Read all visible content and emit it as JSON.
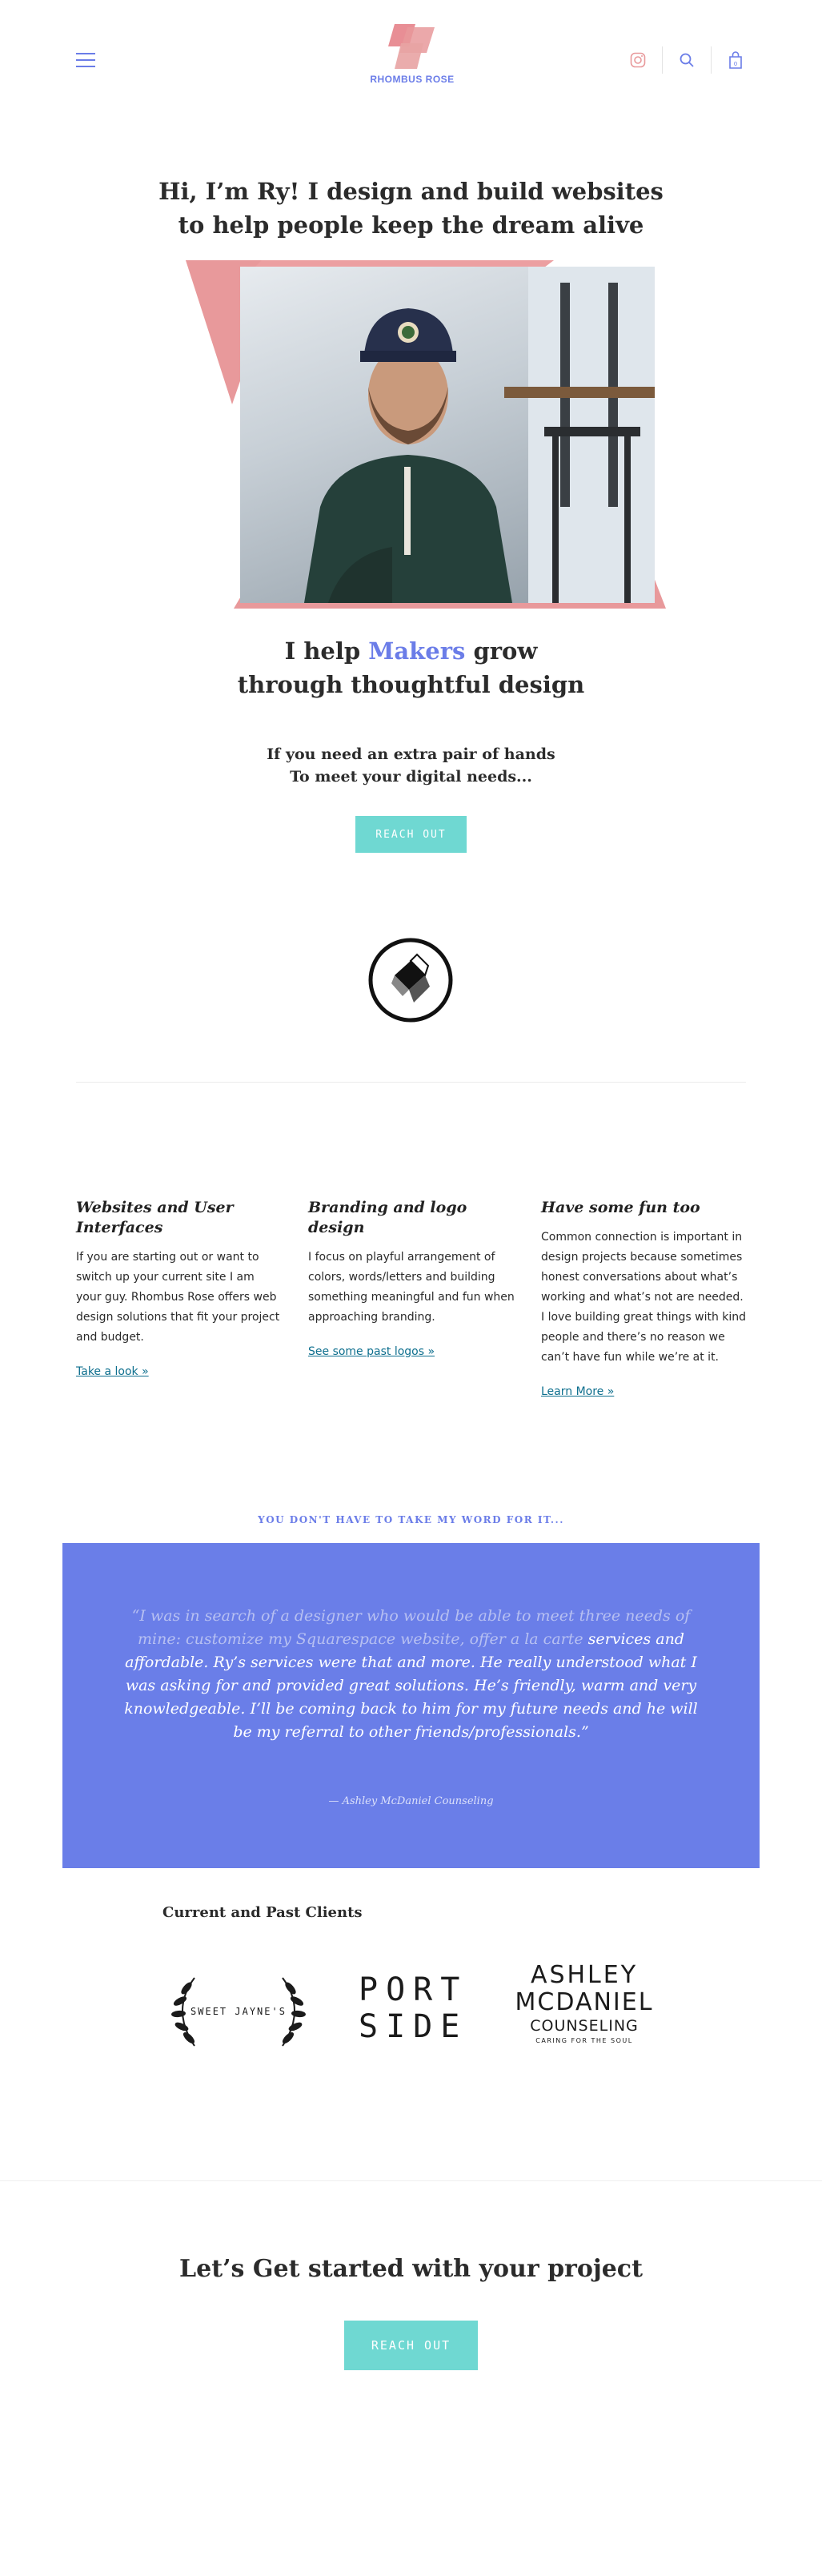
{
  "header": {
    "brand": "RHOMBUS ROSE",
    "cart_count": "0",
    "colors": {
      "accent": "#6b7de8",
      "pink": "#e8999b",
      "teal": "#6fd8d2"
    }
  },
  "hero": {
    "title": "Hi, I’m Ry! I design and build websites to help people keep the dream alive"
  },
  "makers": {
    "prefix": "I help",
    "highlight": "Makers",
    "suffix": "grow",
    "line2": "through thoughtful design"
  },
  "need": {
    "line1": "If you need an extra pair of hands",
    "line2": "To meet your digital needs..."
  },
  "cta_primary": {
    "label": "REACH OUT"
  },
  "services": [
    {
      "title": "Websites and User Interfaces",
      "body": "If you are starting out or want to switch up your current site I am your guy. Rhombus Rose offers web design solutions that fit your project and budget.",
      "link": "Take a look »"
    },
    {
      "title": "Branding and logo design",
      "body": "I focus on playful arrangement of colors, words/letters and building something meaningful  and fun when approaching branding.",
      "link": "See some past logos »"
    },
    {
      "title": "Have some fun too",
      "body": "Common connection is important in design projects because sometimes honest conversations about what’s working and what’s not are needed. I love building great things with kind people and there’s no reason we can’t have fun while we’re at it.",
      "link": "Learn More »"
    }
  ],
  "testimonial": {
    "kicker": "YOU DON'T HAVE TO TAKE MY WORD FOR IT...",
    "quote_faded": "“I was in search of a designer who would be able to meet three needs of mine: customize my Squarespace website, offer a la carte",
    "quote_main": "services and affordable. Ry’s services were that and more. He really understood what I was asking for and provided great solutions. He’s friendly, warm and very knowledgeable. I’ll be coming back to him for my future needs and he will be my referral to other friends/professionals.”",
    "author": "— Ashley McDaniel Counseling"
  },
  "clients": {
    "title": "Current and Past Clients",
    "logos": {
      "sweet_jaynes": "SWEET JAYNE'S",
      "portside_1": "PORT",
      "portside_2": "SIDE",
      "ashley_1": "ASHLEY",
      "ashley_2": "MCDANIEL",
      "ashley_3": "COUNSELING",
      "ashley_4": "CARING FOR THE SOUL"
    }
  },
  "cta_bottom": {
    "title": "Let’s Get started with your project",
    "label": "REACH OUT"
  }
}
